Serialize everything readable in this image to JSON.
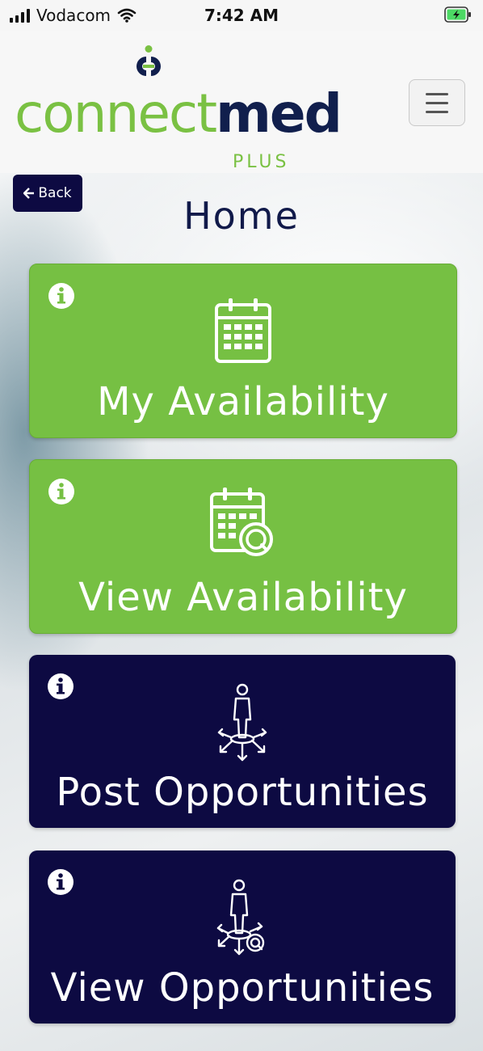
{
  "status_bar": {
    "carrier": "Vodacom",
    "time": "7:42 AM",
    "icons": [
      "signal-icon",
      "wifi-icon",
      "battery-charging-icon"
    ]
  },
  "header": {
    "logo": {
      "connect": "connect",
      "med": "med",
      "plus": "PLUS"
    },
    "menu_icon": "hamburger-menu-icon"
  },
  "back_button": {
    "label": "Back",
    "icon": "arrow-left-icon"
  },
  "page_title": "Home",
  "tiles": [
    {
      "label": "My Availability",
      "icon": "calendar-icon",
      "color": "#76c043"
    },
    {
      "label": "View Availability",
      "icon": "calendar-search-icon",
      "color": "#76c043"
    },
    {
      "label": "Post Opportunities",
      "icon": "person-arrows-icon",
      "color": "#0d0a42"
    },
    {
      "label": "View Opportunities",
      "icon": "person-arrows-search-icon",
      "color": "#0d0a42"
    }
  ],
  "colors": {
    "brand_green": "#7ac143",
    "brand_navy": "#0d0a42"
  }
}
